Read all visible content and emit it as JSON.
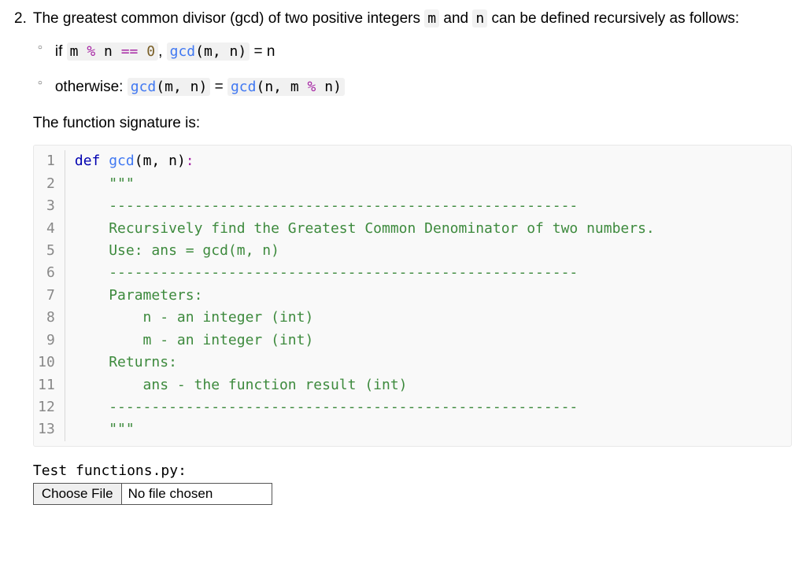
{
  "question": {
    "number": "2.",
    "intro_pre": "The greatest common divisor (gcd) of two positive integers ",
    "intro_code1": "m",
    "intro_mid": " and ",
    "intro_code2": "n",
    "intro_post": " can be defined recursively as follows:",
    "bullets": [
      {
        "prefix": "if ",
        "code_before": "m % n == 0",
        "mid": ", ",
        "code_expr": "gcd(m, n)",
        "suffix_text": " = n"
      },
      {
        "prefix": "otherwise: ",
        "code_l": "gcd(m, n)",
        "assign": " = ",
        "code_r": "gcd(n, m % n)"
      }
    ],
    "sig_label": "The function signature is:"
  },
  "code": {
    "lines": [
      {
        "n": "1",
        "segments": [
          {
            "t": "def ",
            "c": "tok-kw"
          },
          {
            "t": "gcd",
            "c": "tok-def"
          },
          {
            "t": "(",
            "c": "tok-paren2"
          },
          {
            "t": "m",
            "c": "tok-var"
          },
          {
            "t": ", ",
            "c": "tok-var"
          },
          {
            "t": "n",
            "c": "tok-var"
          },
          {
            "t": ")",
            "c": "tok-paren2"
          },
          {
            "t": ":",
            "c": "tok-op2"
          }
        ]
      },
      {
        "n": "2",
        "segments": [
          {
            "t": "    \"\"\"",
            "c": "tok-doc"
          }
        ]
      },
      {
        "n": "3",
        "segments": [
          {
            "t": "    -------------------------------------------------------",
            "c": "tok-doc"
          }
        ]
      },
      {
        "n": "4",
        "segments": [
          {
            "t": "    Recursively find the Greatest Common Denominator of two numbers.",
            "c": "tok-doc"
          }
        ]
      },
      {
        "n": "5",
        "segments": [
          {
            "t": "    Use: ans = gcd(m, n)",
            "c": "tok-doc"
          }
        ]
      },
      {
        "n": "6",
        "segments": [
          {
            "t": "    -------------------------------------------------------",
            "c": "tok-doc"
          }
        ]
      },
      {
        "n": "7",
        "segments": [
          {
            "t": "    Parameters:",
            "c": "tok-doc"
          }
        ]
      },
      {
        "n": "8",
        "segments": [
          {
            "t": "        n - an integer (int)",
            "c": "tok-doc"
          }
        ]
      },
      {
        "n": "9",
        "segments": [
          {
            "t": "        m - an integer (int)",
            "c": "tok-doc"
          }
        ]
      },
      {
        "n": "10",
        "segments": [
          {
            "t": "    Returns:",
            "c": "tok-doc"
          }
        ]
      },
      {
        "n": "11",
        "segments": [
          {
            "t": "        ans - the function result (int)",
            "c": "tok-doc"
          }
        ]
      },
      {
        "n": "12",
        "segments": [
          {
            "t": "    -------------------------------------------------------",
            "c": "tok-doc"
          }
        ]
      },
      {
        "n": "13",
        "segments": [
          {
            "t": "    \"\"\"",
            "c": "tok-doc"
          }
        ]
      }
    ]
  },
  "upload": {
    "label_pre": "Test ",
    "label_file": "functions.py",
    "label_post": ":",
    "button": "Choose File",
    "status": "No file chosen"
  }
}
